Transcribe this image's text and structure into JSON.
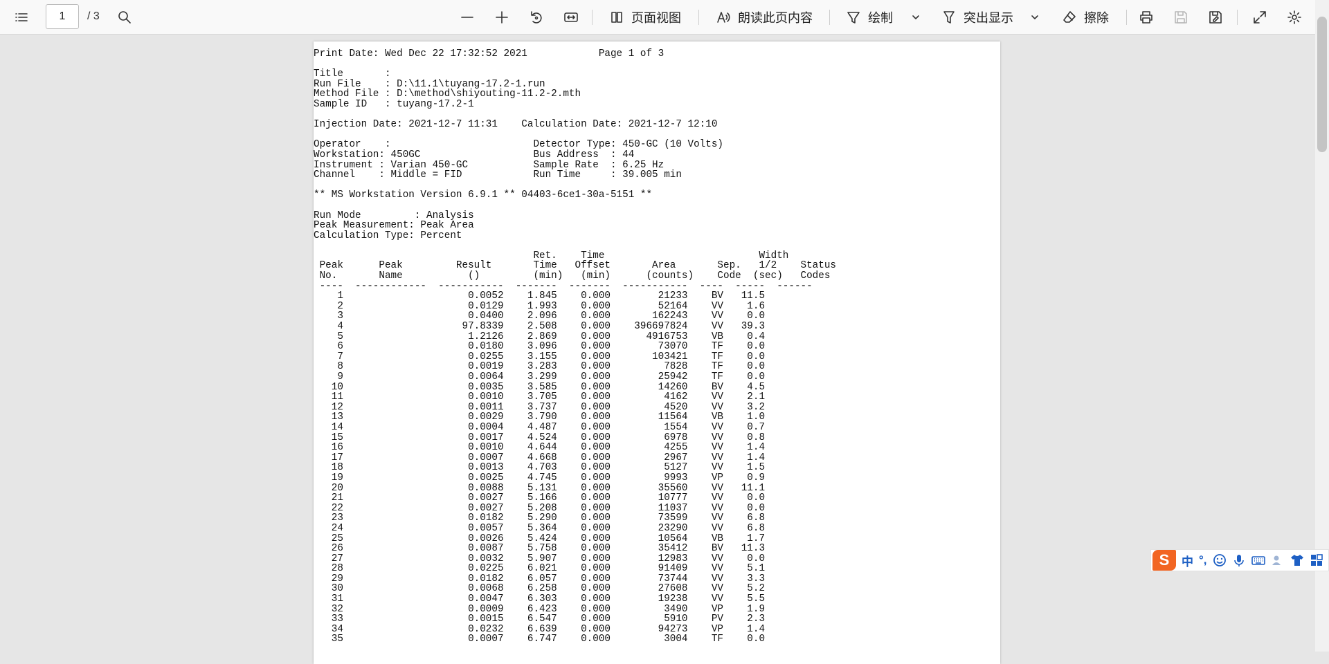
{
  "toolbar": {
    "current_page": "1",
    "total_pages": "/ 3",
    "page_view_label": "页面视图",
    "read_aloud_label": "朗读此页内容",
    "draw_label": "绘制",
    "highlight_label": "突出显示",
    "erase_label": "擦除"
  },
  "document": {
    "header_lines": [
      "Print Date: Wed Dec 22 17:32:52 2021            Page 1 of 3",
      "",
      "Title       :",
      "Run File    : D:\\11.1\\tuyang-17.2-1.run",
      "Method File : D:\\method\\shiyouting-11.2-2.mth",
      "Sample ID   : tuyang-17.2-1",
      "",
      "Injection Date: 2021-12-7 11:31    Calculation Date: 2021-12-7 12:10",
      "",
      "Operator    :                        Detector Type: 450-GC (10 Volts)",
      "Workstation: 450GC                   Bus Address  : 44",
      "Instrument : Varian 450-GC           Sample Rate  : 6.25 Hz",
      "Channel    : Middle = FID            Run Time     : 39.005 min",
      "",
      "** MS Workstation Version 6.9.1 ** 04403-6ce1-30a-5151 **",
      "",
      "Run Mode         : Analysis",
      "Peak Measurement: Peak Area",
      "Calculation Type: Percent",
      ""
    ],
    "table_header_lines": [
      "                                     Ret.    Time                          Width",
      " Peak      Peak         Result       Time   Offset       Area       Sep.   1/2    Status",
      " No.       Name           ()         (min)   (min)      (counts)    Code  (sec)   Codes",
      " ----  ------------  -----------  -------  -------  -----------  ----  -----  ------"
    ],
    "rows": [
      [
        "1",
        "",
        "0.0052",
        "1.845",
        "0.000",
        "21233",
        "BV",
        "11.5"
      ],
      [
        "2",
        "",
        "0.0129",
        "1.993",
        "0.000",
        "52164",
        "VV",
        "1.6"
      ],
      [
        "3",
        "",
        "0.0400",
        "2.096",
        "0.000",
        "162243",
        "VV",
        "0.0"
      ],
      [
        "4",
        "",
        "97.8339",
        "2.508",
        "0.000",
        "396697824",
        "VV",
        "39.3"
      ],
      [
        "5",
        "",
        "1.2126",
        "2.869",
        "0.000",
        "4916753",
        "VB",
        "0.4"
      ],
      [
        "6",
        "",
        "0.0180",
        "3.096",
        "0.000",
        "73070",
        "TF",
        "0.0"
      ],
      [
        "7",
        "",
        "0.0255",
        "3.155",
        "0.000",
        "103421",
        "TF",
        "0.0"
      ],
      [
        "8",
        "",
        "0.0019",
        "3.283",
        "0.000",
        "7828",
        "TF",
        "0.0"
      ],
      [
        "9",
        "",
        "0.0064",
        "3.299",
        "0.000",
        "25942",
        "TF",
        "0.0"
      ],
      [
        "10",
        "",
        "0.0035",
        "3.585",
        "0.000",
        "14260",
        "BV",
        "4.5"
      ],
      [
        "11",
        "",
        "0.0010",
        "3.705",
        "0.000",
        "4162",
        "VV",
        "2.1"
      ],
      [
        "12",
        "",
        "0.0011",
        "3.737",
        "0.000",
        "4520",
        "VV",
        "3.2"
      ],
      [
        "13",
        "",
        "0.0029",
        "3.790",
        "0.000",
        "11564",
        "VB",
        "1.0"
      ],
      [
        "14",
        "",
        "0.0004",
        "4.487",
        "0.000",
        "1554",
        "VV",
        "0.7"
      ],
      [
        "15",
        "",
        "0.0017",
        "4.524",
        "0.000",
        "6978",
        "VV",
        "0.8"
      ],
      [
        "16",
        "",
        "0.0010",
        "4.644",
        "0.000",
        "4255",
        "VV",
        "1.4"
      ],
      [
        "17",
        "",
        "0.0007",
        "4.668",
        "0.000",
        "2967",
        "VV",
        "1.4"
      ],
      [
        "18",
        "",
        "0.0013",
        "4.703",
        "0.000",
        "5127",
        "VV",
        "1.5"
      ],
      [
        "19",
        "",
        "0.0025",
        "4.745",
        "0.000",
        "9993",
        "VP",
        "0.9"
      ],
      [
        "20",
        "",
        "0.0088",
        "5.131",
        "0.000",
        "35560",
        "VV",
        "11.1"
      ],
      [
        "21",
        "",
        "0.0027",
        "5.166",
        "0.000",
        "10777",
        "VV",
        "0.0"
      ],
      [
        "22",
        "",
        "0.0027",
        "5.208",
        "0.000",
        "11037",
        "VV",
        "0.0"
      ],
      [
        "23",
        "",
        "0.0182",
        "5.290",
        "0.000",
        "73599",
        "VV",
        "6.8"
      ],
      [
        "24",
        "",
        "0.0057",
        "5.364",
        "0.000",
        "23290",
        "VV",
        "6.8"
      ],
      [
        "25",
        "",
        "0.0026",
        "5.424",
        "0.000",
        "10564",
        "VB",
        "1.7"
      ],
      [
        "26",
        "",
        "0.0087",
        "5.758",
        "0.000",
        "35412",
        "BV",
        "11.3"
      ],
      [
        "27",
        "",
        "0.0032",
        "5.907",
        "0.000",
        "12983",
        "VV",
        "0.0"
      ],
      [
        "28",
        "",
        "0.0225",
        "6.021",
        "0.000",
        "91409",
        "VV",
        "5.1"
      ],
      [
        "29",
        "",
        "0.0182",
        "6.057",
        "0.000",
        "73744",
        "VV",
        "3.3"
      ],
      [
        "30",
        "",
        "0.0068",
        "6.258",
        "0.000",
        "27608",
        "VV",
        "5.2"
      ],
      [
        "31",
        "",
        "0.0047",
        "6.303",
        "0.000",
        "19238",
        "VV",
        "5.5"
      ],
      [
        "32",
        "",
        "0.0009",
        "6.423",
        "0.000",
        "3490",
        "VP",
        "1.9"
      ],
      [
        "33",
        "",
        "0.0015",
        "6.547",
        "0.000",
        "5910",
        "PV",
        "2.3"
      ],
      [
        "34",
        "",
        "0.0232",
        "6.639",
        "0.000",
        "94273",
        "VP",
        "1.4"
      ],
      [
        "35",
        "",
        "0.0007",
        "6.747",
        "0.000",
        "3004",
        "TF",
        "0.0"
      ]
    ]
  },
  "ime": {
    "logo": "S",
    "lang": "中",
    "punct": "°,"
  }
}
